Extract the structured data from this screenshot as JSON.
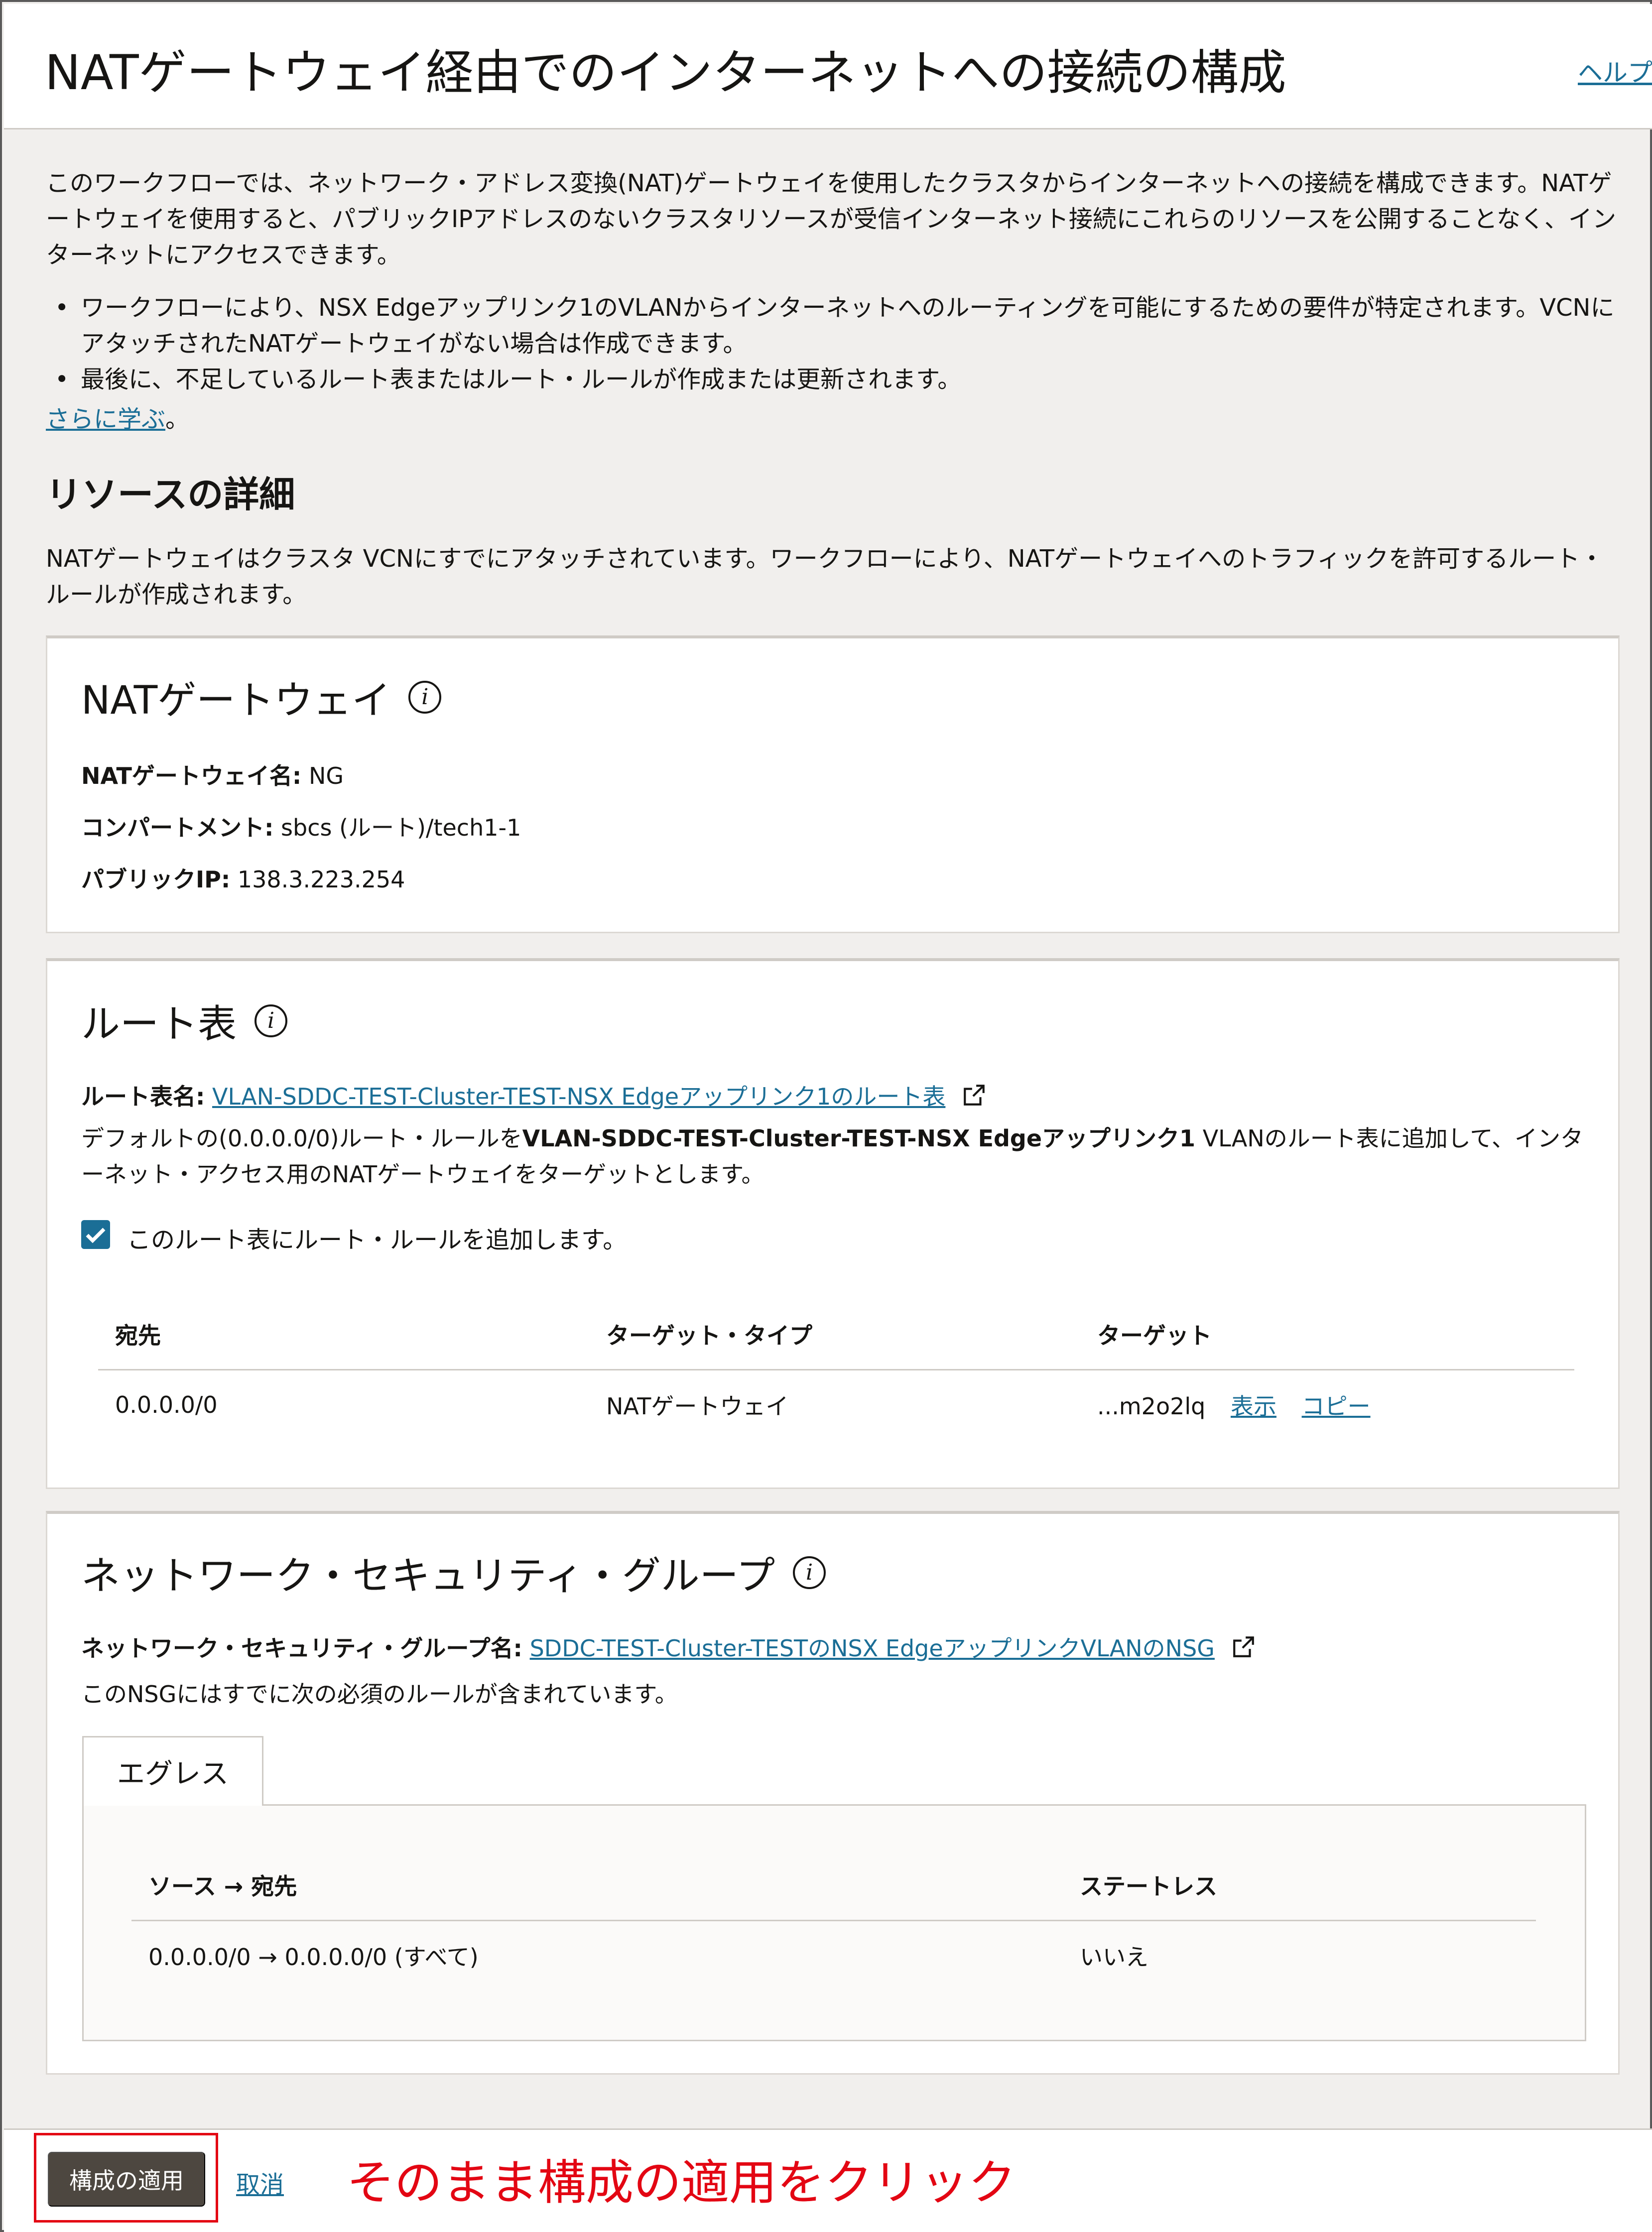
{
  "header": {
    "title": "NATゲートウェイ経由でのインターネットへの接続の構成",
    "help": "ヘルプ"
  },
  "intro": {
    "text": "このワークフローでは、ネットワーク・アドレス変換(NAT)ゲートウェイを使用したクラスタからインターネットへの接続を構成できます。NATゲートウェイを使用すると、パブリックIPアドレスのないクラスタリソースが受信インターネット接続にこれらのリソースを公開することなく、インターネットにアクセスできます。",
    "bullets": [
      "ワークフローにより、NSX Edgeアップリンク1のVLANからインターネットへのルーティングを可能にするための要件が特定されます。VCNにアタッチされたNATゲートウェイがない場合は作成できます。",
      "最後に、不足しているルート表またはルート・ルールが作成または更新されます。"
    ],
    "learn_more": "さらに学ぶ",
    "learn_more_suffix": "。"
  },
  "resources": {
    "title": "リソースの詳細",
    "description": "NATゲートウェイはクラスタ VCNにすでにアタッチされています。ワークフローにより、NATゲートウェイへのトラフィックを許可するルート・ルールが作成されます。"
  },
  "nat_card": {
    "title": "NATゲートウェイ",
    "name_label": "NATゲートウェイ名:",
    "name_value": "NG",
    "compartment_label": "コンパートメント:",
    "compartment_value": "sbcs (ルート)/tech1-1",
    "public_ip_label": "パブリックIP:",
    "public_ip_value": "138.3.223.254"
  },
  "route_card": {
    "title": "ルート表",
    "name_label": "ルート表名:",
    "name_link": "VLAN-SDDC-TEST-Cluster-TEST-NSX Edgeアップリンク1のルート表",
    "desc_prefix": "デフォルトの(0.0.0.0/0)ルート・ルールを",
    "desc_bold": "VLAN-SDDC-TEST-Cluster-TEST-NSX Edgeアップリンク1",
    "desc_suffix": " VLANのルート表に追加して、インターネット・アクセス用のNATゲートウェイをターゲットとします。",
    "checkbox_label": "このルート表にルート・ルールを追加します。",
    "checkbox_checked": true,
    "columns": [
      "宛先",
      "ターゲット・タイプ",
      "ターゲット"
    ],
    "rows": [
      {
        "destination": "0.0.0.0/0",
        "target_type": "NATゲートウェイ",
        "target": "...m2o2lq",
        "show": "表示",
        "copy": "コピー"
      }
    ]
  },
  "nsg_card": {
    "title": "ネットワーク・セキュリティ・グループ",
    "name_label": "ネットワーク・セキュリティ・グループ名:",
    "name_link": "SDDC-TEST-Cluster-TESTのNSX EdgeアップリンクVLANのNSG",
    "description": "このNSGにはすでに次の必須のルールが含まれています。",
    "tab": "エグレス",
    "columns": [
      "ソース → 宛先",
      "ステートレス"
    ],
    "rows": [
      {
        "route": "0.0.0.0/0 → 0.0.0.0/0 (すべて)",
        "stateless": "いいえ"
      }
    ]
  },
  "footer": {
    "apply": "構成の適用",
    "cancel": "取消",
    "annotation": "そのまま構成の適用をクリック"
  },
  "colors": {
    "link": "#1b6e96",
    "annotation": "#e30613",
    "primary_button": "#4d4740",
    "background": "#f1efed"
  }
}
